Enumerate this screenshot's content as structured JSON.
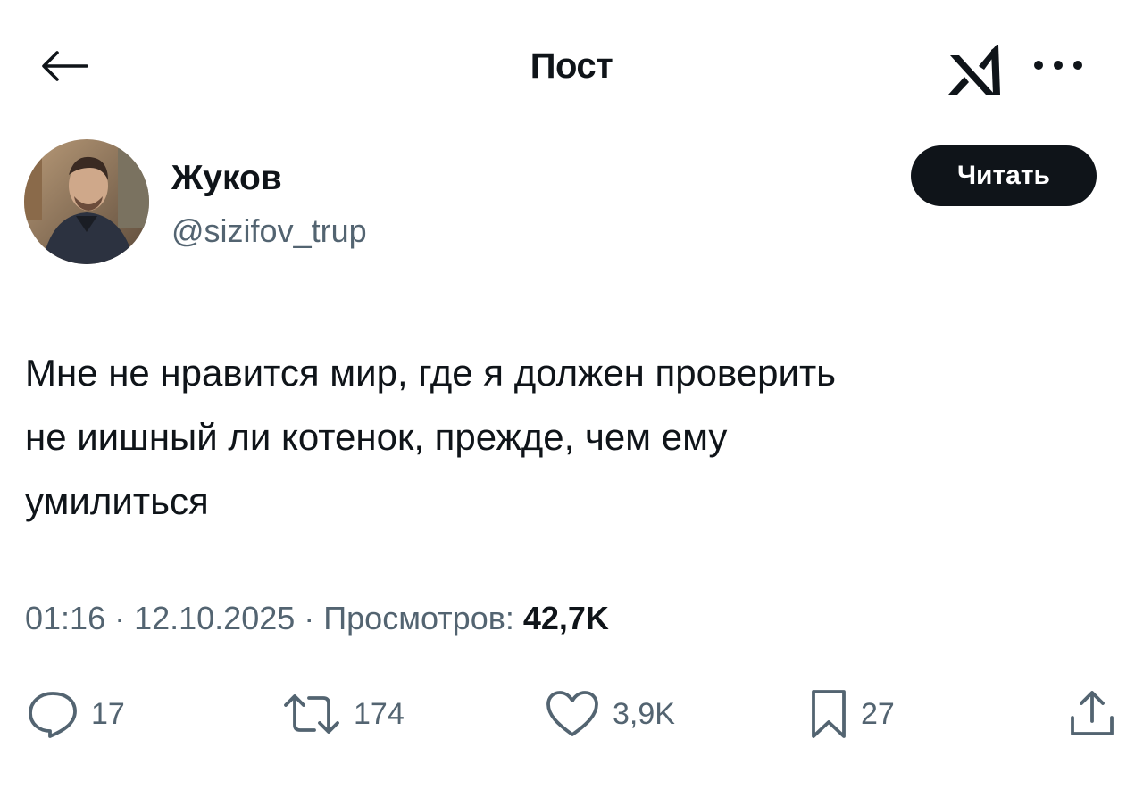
{
  "header": {
    "title": "Пост"
  },
  "author": {
    "name": "Жуков",
    "handle": "@sizifov_trup",
    "follow_label": "Читать"
  },
  "post": {
    "lines": [
      "Мне не нравится мир, где я должен проверить",
      "не иишный ли котенок, прежде, чем ему",
      "умилиться"
    ]
  },
  "meta": {
    "time": "01:16",
    "sep1": " · ",
    "date": "12.10.2025",
    "sep2": " · ",
    "views_label": "Просмотров: ",
    "views_value": "42,7K"
  },
  "actions": [
    {
      "name": "reply",
      "icon": "speech-bubble-icon",
      "count": "17"
    },
    {
      "name": "retweet",
      "icon": "repost-icon",
      "count": "174"
    },
    {
      "name": "like",
      "icon": "heart-icon",
      "count": "3,9K"
    },
    {
      "name": "bookmark",
      "icon": "bookmark-icon",
      "count": "27"
    },
    {
      "name": "share",
      "icon": "share-icon"
    }
  ]
}
